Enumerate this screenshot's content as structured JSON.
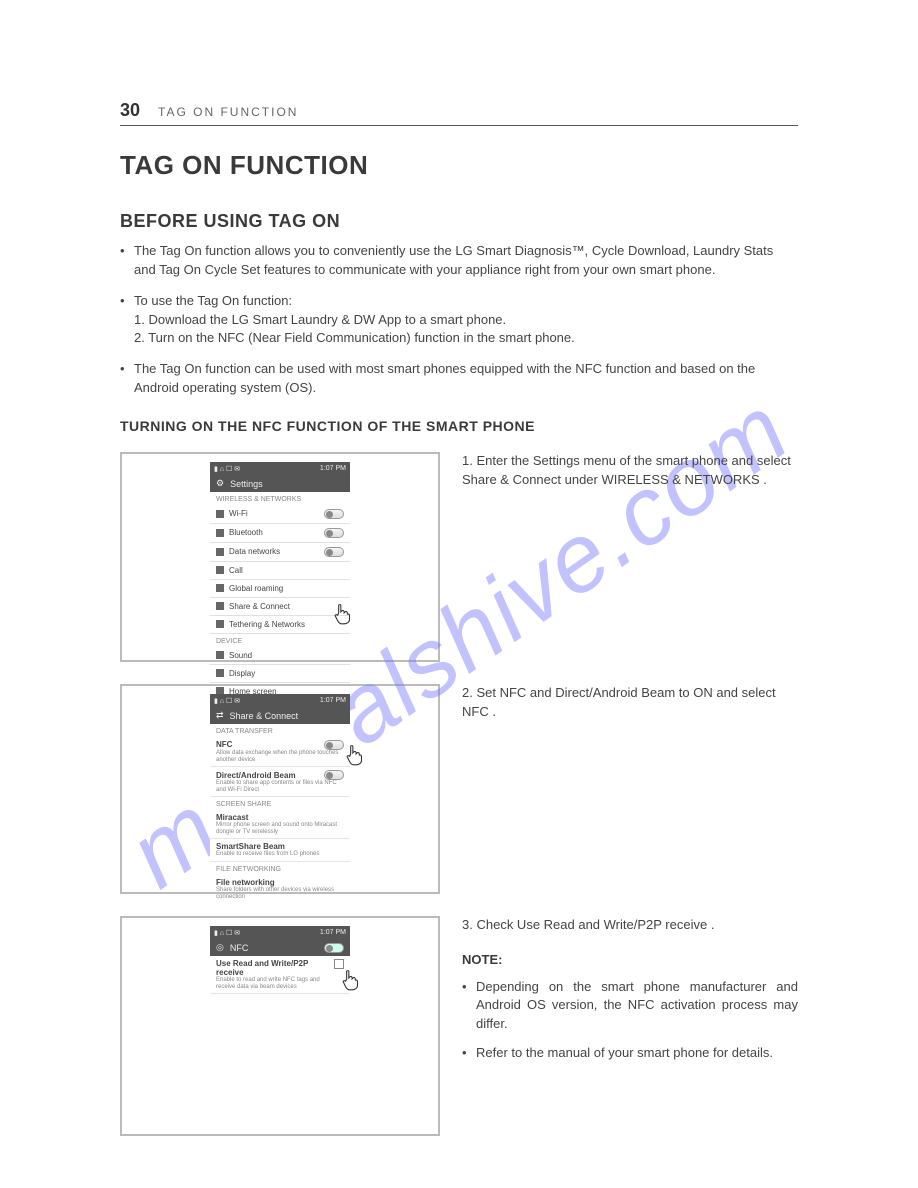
{
  "watermark": "manualshive.com",
  "header": {
    "page_number": "30",
    "running_title": "TAG ON FUNCTION"
  },
  "title": "TAG ON FUNCTION",
  "section_before": {
    "heading": "BEFORE USING TAG ON",
    "bullets": [
      "The Tag On function allows you to conveniently use the LG Smart Diagnosis™, Cycle Download, Laundry Stats and Tag On Cycle Set features to communicate with your appliance right from your own smart phone.",
      "To use the Tag On function:",
      "The Tag On function can be used with most smart phones equipped with the NFC function and based on the Android operating system (OS)."
    ],
    "sublist": [
      "1. Download the LG Smart Laundry & DW App to a smart phone.",
      "2. Turn on the NFC (Near Field Communication) function in the smart phone."
    ]
  },
  "section_nfc": {
    "heading": "TURNING ON THE NFC FUNCTION OF THE SMART PHONE",
    "steps": [
      {
        "num": "1.",
        "text": "Enter the  Settings  menu of the smart phone and select  Share & Connect  under  WIRELESS & NETWORKS ."
      },
      {
        "num": "2.",
        "text": "Set  NFC  and  Direct/Android Beam  to ON and select  NFC ."
      },
      {
        "num": "3.",
        "text": "Check  Use Read and Write/P2P receive ."
      }
    ],
    "note_heading": "NOTE:",
    "notes": [
      "Depending on the smart phone manufacturer and Android OS version, the NFC activation process may differ.",
      "Refer to the manual of your smart phone for details."
    ]
  },
  "phone1": {
    "status_time": "1:07 PM",
    "title": "Settings",
    "section_a": "WIRELESS & NETWORKS",
    "items_a": [
      {
        "label": "Wi-Fi",
        "toggle": true
      },
      {
        "label": "Bluetooth",
        "toggle": true
      },
      {
        "label": "Data networks",
        "toggle": true
      },
      {
        "label": "Call"
      },
      {
        "label": "Global roaming"
      },
      {
        "label": "Share & Connect"
      },
      {
        "label": "Tethering & Networks"
      }
    ],
    "section_b": "DEVICE",
    "items_b": [
      {
        "label": "Sound"
      },
      {
        "label": "Display"
      },
      {
        "label": "Home screen"
      }
    ]
  },
  "phone2": {
    "status_time": "1:07 PM",
    "title": "Share & Connect",
    "section_a": "DATA TRANSFER",
    "blocks_a": [
      {
        "t": "NFC",
        "d": "Allow data exchange when the phone touches another device",
        "toggle": true
      },
      {
        "t": "Direct/Android Beam",
        "d": "Enable to share app contents or files via NFC and Wi-Fi Direct",
        "toggle": true
      }
    ],
    "section_b": "SCREEN SHARE",
    "blocks_b": [
      {
        "t": "Miracast",
        "d": "Mirror phone screen and sound onto Miracast dongle or TV wirelessly"
      },
      {
        "t": "SmartShare Beam",
        "d": "Enable to receive files from LG phones"
      }
    ],
    "section_c": "FILE NETWORKING",
    "blocks_c": [
      {
        "t": "File networking",
        "d": "Share folders with other devices via wireless connection"
      }
    ]
  },
  "phone3": {
    "status_time": "1:07 PM",
    "title": "NFC",
    "toggle_on": "ON",
    "block": {
      "t": "Use Read and Write/P2P receive",
      "d": "Enable to read and write NFC tags and receive data via beam devices"
    }
  }
}
